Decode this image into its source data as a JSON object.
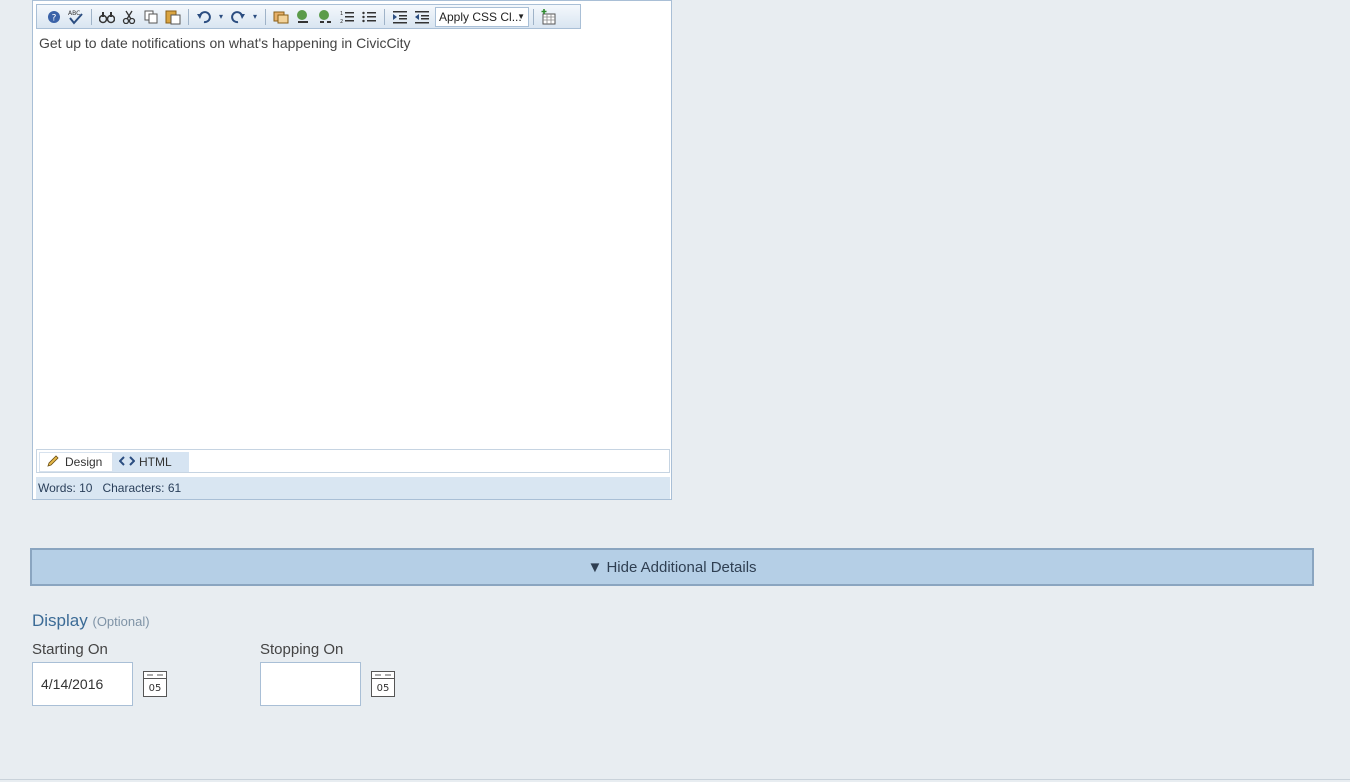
{
  "editor": {
    "content": "Get up to date notifications on what's happening in CivicCity",
    "css_select": "Apply CSS Cl...",
    "tabs": [
      {
        "label": "Design"
      },
      {
        "label": "HTML"
      }
    ],
    "status": {
      "words": "Words: 10",
      "characters": "Characters: 61"
    }
  },
  "details_toggle": {
    "label": "▼ Hide Additional Details"
  },
  "display": {
    "title": "Display",
    "optional": "(Optional)",
    "starting_on": {
      "label": "Starting On",
      "value": "4/14/2016"
    },
    "stopping_on": {
      "label": "Stopping On",
      "value": ""
    },
    "calendar_day": "05"
  }
}
